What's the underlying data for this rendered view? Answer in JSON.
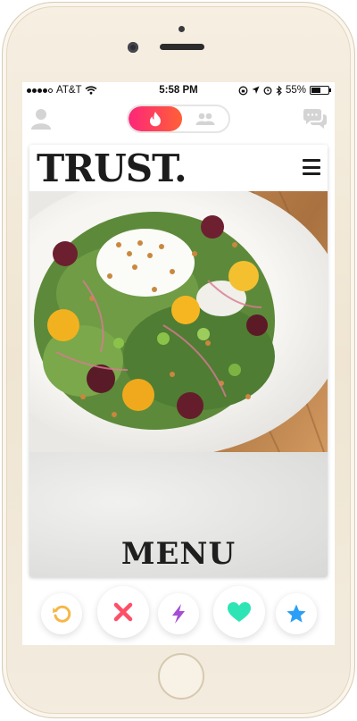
{
  "status_bar": {
    "carrier": "AT&T",
    "time": "5:58 PM",
    "battery": "55%",
    "battery_level": 0.55
  },
  "header": {
    "mode_active": "flame-icon",
    "mode_inactive": "group-icon"
  },
  "card": {
    "brand": "TRUST.",
    "menu_label": "MENU"
  },
  "actions": {
    "items": [
      "rewind-icon",
      "nope-icon",
      "boost-icon",
      "like-icon",
      "super-like-icon"
    ]
  },
  "colors": {
    "accent_gradient": [
      "#fd267a",
      "#ff6036"
    ],
    "rewind": "#f5b748",
    "nope": "#fd5068",
    "boost": "#a54ed3",
    "like": "#2de5b4",
    "super_like": "#2b9ef7"
  }
}
